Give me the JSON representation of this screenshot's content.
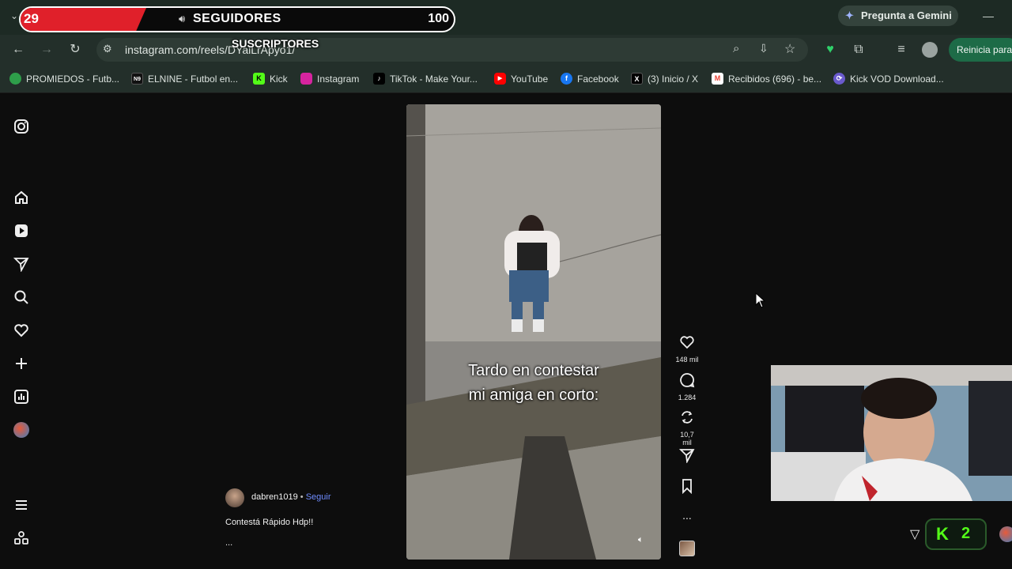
{
  "overlay": {
    "count_current": "29",
    "count_goal": "100",
    "label_main": "SEGUIDORES",
    "label_sub": "SUSCRIPTORES",
    "progress_fraction": 0.29
  },
  "browser": {
    "gemini_label": "Pregunta a Gemini",
    "url": "instagram.com/reels/DYaiLrApyo1/",
    "restart_label": "Reinicia para",
    "bookmarks": [
      {
        "label": "PROMIEDOS - Futb...",
        "icon": "promiedos-icon",
        "color": "#2e9e4a"
      },
      {
        "label": "ELNINE - Futbol en...",
        "icon": "elnine-icon",
        "color": "#111111"
      },
      {
        "label": "Kick",
        "icon": "kick-icon",
        "color": "#53fc18"
      },
      {
        "label": "Instagram",
        "icon": "instagram-icon",
        "color": "#d6249f"
      },
      {
        "label": "TikTok - Make Your...",
        "icon": "tiktok-icon",
        "color": "#000000"
      },
      {
        "label": "YouTube",
        "icon": "youtube-icon",
        "color": "#ff0000"
      },
      {
        "label": "Facebook",
        "icon": "facebook-icon",
        "color": "#1877f2"
      },
      {
        "label": "(3) Inicio / X",
        "icon": "x-icon",
        "color": "#000000"
      },
      {
        "label": "Recibidos (696) - be...",
        "icon": "gmail-icon",
        "color": "#ea4335"
      },
      {
        "label": "Kick VOD Download...",
        "icon": "kickvod-icon",
        "color": "#6a5acd"
      }
    ]
  },
  "reel": {
    "caption_line1": "Tardo en contestar",
    "caption_line2": "mi amiga en corto:",
    "username": "dabren1019",
    "separator": "•",
    "follow_label": "Seguir",
    "description": "Contestá Rápido Hdp!!",
    "more": "...",
    "likes": "148 mil",
    "comments": "1.284",
    "reposts": "10,7 mil",
    "more_actions": "..."
  },
  "kick_widget": {
    "count": "2"
  }
}
